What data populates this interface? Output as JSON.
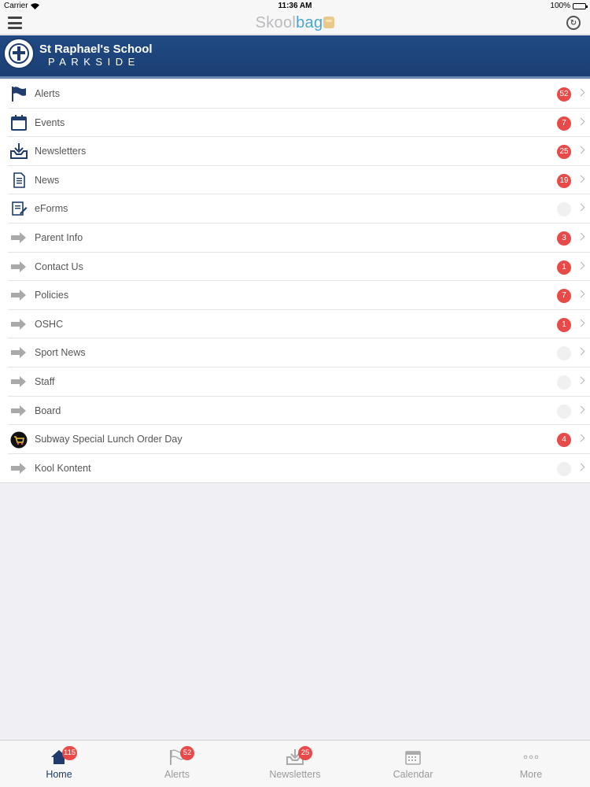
{
  "status_bar": {
    "carrier": "Carrier",
    "time": "11:36 AM",
    "battery": "100%"
  },
  "nav": {
    "logo_part1": "Skool",
    "logo_part2": "bag"
  },
  "school": {
    "name": "St Raphael's School",
    "subtitle": "PARKSIDE"
  },
  "menu": {
    "items": [
      {
        "label": "Alerts",
        "badge": "52",
        "icon": "flag-icon"
      },
      {
        "label": "Events",
        "badge": "7",
        "icon": "calendar-icon"
      },
      {
        "label": "Newsletters",
        "badge": "25",
        "icon": "inbox-download-icon"
      },
      {
        "label": "News",
        "badge": "19",
        "icon": "document-icon"
      },
      {
        "label": "eForms",
        "badge": "",
        "icon": "form-icon"
      },
      {
        "label": "Parent Info",
        "badge": "3",
        "icon": "arrow-icon"
      },
      {
        "label": "Contact Us",
        "badge": "1",
        "icon": "arrow-icon"
      },
      {
        "label": "Policies",
        "badge": "7",
        "icon": "arrow-icon"
      },
      {
        "label": "OSHC",
        "badge": "1",
        "icon": "arrow-icon"
      },
      {
        "label": "Sport News",
        "badge": "",
        "icon": "arrow-icon"
      },
      {
        "label": "Staff",
        "badge": "",
        "icon": "arrow-icon"
      },
      {
        "label": "Board",
        "badge": "",
        "icon": "arrow-icon"
      },
      {
        "label": "Subway Special Lunch Order Day",
        "badge": "4",
        "icon": "shopping-cart-icon"
      },
      {
        "label": "Kool Kontent",
        "badge": "",
        "icon": "arrow-icon"
      }
    ]
  },
  "tabs": [
    {
      "label": "Home",
      "badge": "115",
      "icon": "home-icon"
    },
    {
      "label": "Alerts",
      "badge": "52",
      "icon": "flag-icon"
    },
    {
      "label": "Newsletters",
      "badge": "25",
      "icon": "inbox-download-icon"
    },
    {
      "label": "Calendar",
      "badge": "",
      "icon": "calendar-icon"
    },
    {
      "label": "More",
      "badge": "",
      "icon": "more-dots-icon"
    }
  ],
  "colors": {
    "header_blue": "#1a3f74",
    "badge_red": "#e84a49",
    "logo_blue": "#4aa6cf",
    "active_tab": "#1f3c6d"
  }
}
